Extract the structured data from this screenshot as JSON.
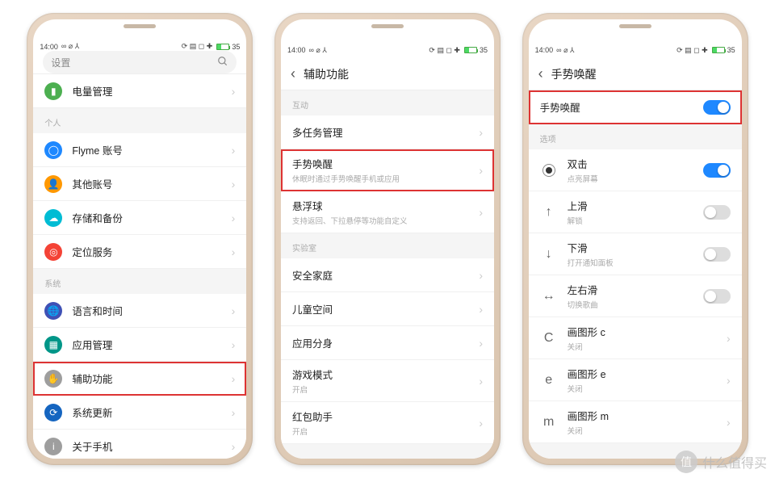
{
  "status": {
    "time": "14:00",
    "battery": "35"
  },
  "screen1": {
    "search_placeholder": "设置",
    "sec_personal": "个人",
    "sec_system": "系统",
    "rows": {
      "power": "电量管理",
      "flyme": "Flyme 账号",
      "other_acct": "其他账号",
      "storage": "存储和备份",
      "location": "定位服务",
      "lang": "语言和时间",
      "apps": "应用管理",
      "access": "辅助功能",
      "update": "系统更新",
      "about": "关于手机"
    }
  },
  "screen2": {
    "title": "辅助功能",
    "sec_interact": "互动",
    "sec_lab": "实验室",
    "rows": {
      "multitask": "多任务管理",
      "gesture": "手势唤醒",
      "gesture_sub": "休眠时通过手势唤醒手机或应用",
      "float": "悬浮球",
      "float_sub": "支持返回、下拉悬停等功能自定义",
      "safehome": "安全家庭",
      "kids": "儿童空间",
      "clone": "应用分身",
      "game": "游戏模式",
      "game_sub": "开启",
      "redpack": "红包助手",
      "redpack_sub": "开启"
    }
  },
  "screen3": {
    "title": "手势唤醒",
    "master": "手势唤醒",
    "sec_options": "选项",
    "rows": {
      "double_tap": "双击",
      "double_tap_sub": "点亮屏幕",
      "swipe_up": "上滑",
      "swipe_up_sub": "解锁",
      "swipe_down": "下滑",
      "swipe_down_sub": "打开通知面板",
      "swipe_left": "左右滑",
      "swipe_left_sub": "切换歌曲",
      "draw_c": "画图形 c",
      "draw_c_sub": "关闭",
      "draw_e": "画图形 e",
      "draw_e_sub": "关闭",
      "draw_m": "画图形 m",
      "draw_m_sub": "关闭"
    }
  },
  "watermark": "什么值得买"
}
